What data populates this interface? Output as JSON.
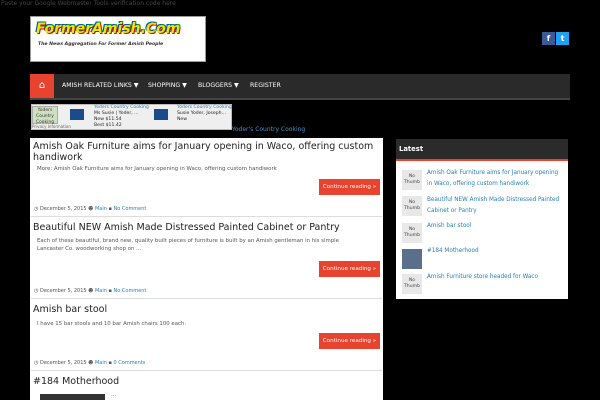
{
  "verification_note": "Paste your Google Webmaster Tools verification code here",
  "logo": {
    "text": "FormerAmish.Com",
    "tagline": "The News Aggregation For Former Amish People"
  },
  "social": {
    "facebook": "f",
    "twitter": "t"
  },
  "nav": {
    "home_icon": "home-icon",
    "items": [
      "AMISH RELATED LINKS ▼",
      "SHOPPING ▼",
      "BLOGGERS ▼",
      "REGISTER"
    ]
  },
  "ads": {
    "badge": "Yoders Country Cooking",
    "items": [
      {
        "title": "Yoders Country Cooking",
        "author": "Ms Susie | Yoder, ...",
        "tag": "New",
        "price": "$11.54",
        "best": "Best $11.42"
      },
      {
        "title": "Yoders Country Cooking",
        "author": "Susie Yoder, Joseph...",
        "tag": "New",
        "price": "",
        "best": ""
      }
    ],
    "caption": "Privacy Information",
    "link_text": "Yoder's Country Cooking"
  },
  "posts": [
    {
      "title": "Amish Oak Furniture aims for January opening in Waco, offering custom handiwork",
      "excerpt": "More:  Amish Oak Furniture aims for January opening in Waco, offering custom handiwork",
      "button": "Continue reading »",
      "date": "December 5, 2015",
      "author": "Main",
      "comments": "No Comment"
    },
    {
      "title": "Beautiful NEW Amish Made Distressed Painted Cabinet or Pantry",
      "excerpt": "Each of these beautiful, brand new, quality built pieces of furniture is built by an Amish gentleman in his simple Lancaster Co. woodworking shop on ...",
      "button": "Continue reading »",
      "date": "December 5, 2015",
      "author": "Main",
      "comments": "No Comment"
    },
    {
      "title": "Amish bar stool",
      "excerpt": "I have 15 bar stools and 10 bar Amish chairs 100 each.",
      "button": "Continue reading »",
      "date": "December 5, 2015",
      "author": "Main",
      "comments": "0 Comments"
    },
    {
      "title": "#184 Motherhood",
      "excerpt": "...",
      "button": "",
      "date": "",
      "author": "",
      "comments": ""
    }
  ],
  "sidebar": {
    "title": "Latest",
    "no_thumb": "No Thumb",
    "items": [
      "Amish Oak Furniture aims for January opening in Waco, offering custom handiwork",
      "Beautiful NEW Amish Made Distressed Painted Cabinet or Pantry",
      "Amish bar stool",
      "#184 Motherhood",
      "Amish Furniture store headed for Waco"
    ]
  },
  "colors": {
    "accent": "#e8432e",
    "link": "#2a7fb8",
    "nav_bg": "#2a2a2a",
    "page_bg": "#000000"
  }
}
